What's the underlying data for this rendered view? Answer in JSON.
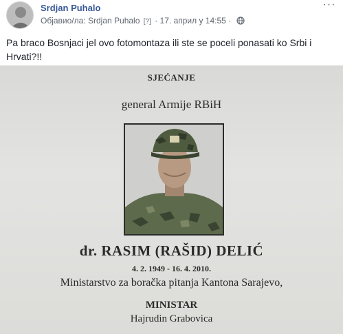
{
  "post": {
    "author": "Srdjan Puhalo",
    "published_by_label": "Објавио/ла:",
    "published_by_name": "Srdjan Puhalo",
    "info_mark": "[?]",
    "separator": "·",
    "date": "17. април у 14:55",
    "privacy_icon": "globe-icon",
    "more_icon": "more-options-icon",
    "text": "Pa braco Bosnjaci jel ovo fotomontaza ili ste se poceli ponasati ko Srbi i Hrvati?!!"
  },
  "photo": {
    "heading": "SJEĆANJE",
    "rank": "general Armije RBiH",
    "name": "dr. RASIM (RAŠID) DELIĆ",
    "dates": "4. 2. 1949 - 16. 4. 2010.",
    "ministry": "Ministarstvo za boračka pitanja Kantona Sarajevo,",
    "role": "MINISTAR",
    "signer": "Hajrudin Grabovica"
  },
  "colors": {
    "author_link": "#385898",
    "meta_text": "#606770",
    "body_text": "#1d2129",
    "paper": "#dcdcd9"
  }
}
